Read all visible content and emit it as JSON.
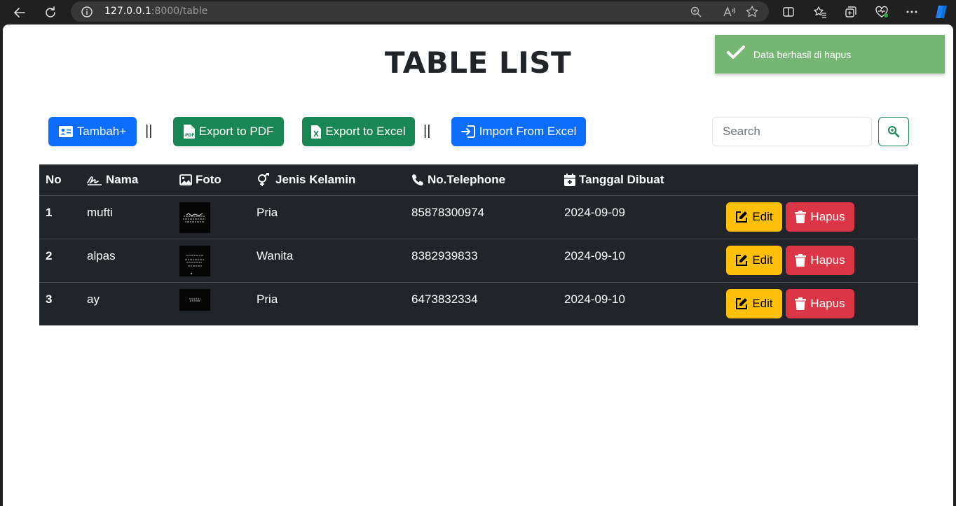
{
  "browser": {
    "url_host": "127.0.0.1",
    "url_rest": ":8000/table"
  },
  "page": {
    "title": "TABLE LIST"
  },
  "toolbar": {
    "add_label": "Tambah+",
    "separator": "||",
    "export_pdf_label": "Export to PDF",
    "export_excel_label": "Export to Excel",
    "import_excel_label": "Import From Excel",
    "search_placeholder": "Search"
  },
  "table": {
    "headers": {
      "no": "No",
      "nama": "Nama",
      "foto": "Foto",
      "jenis_kelamin": "Jenis Kelamin",
      "telephone": "No.Telephone",
      "tanggal": "Tanggal Dibuat"
    },
    "rows": [
      {
        "no": "1",
        "nama": "mufti",
        "jenis_kelamin": "Pria",
        "telephone": "85878300974",
        "tanggal": "2024-09-09",
        "edit": "Edit",
        "hapus": "Hapus"
      },
      {
        "no": "2",
        "nama": "alpas",
        "jenis_kelamin": "Wanita",
        "telephone": "8382939833",
        "tanggal": "2024-09-10",
        "edit": "Edit",
        "hapus": "Hapus"
      },
      {
        "no": "3",
        "nama": "ay",
        "jenis_kelamin": "Pria",
        "telephone": "6473832334",
        "tanggal": "2024-09-10",
        "edit": "Edit",
        "hapus": "Hapus"
      }
    ]
  },
  "toast": {
    "message": "Data berhasil di hapus"
  },
  "colors": {
    "primary": "#0d6efd",
    "success": "#198754",
    "warning": "#ffc107",
    "danger": "#dc3545",
    "table_dark": "#212529",
    "toast": "#75b673"
  }
}
